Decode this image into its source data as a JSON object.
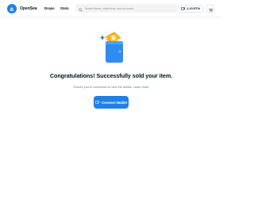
{
  "header": {
    "brand": "OpenSea",
    "nav": [
      "Drops",
      "Stats"
    ],
    "search_placeholder": "Search items, collections, and accounts",
    "balance": "2.15 ETH"
  },
  "main": {
    "headline": "Congratulations! Successfully sold your item.",
    "subtext": "Ensure you're connected to view the details.",
    "learn_more": "Learn more",
    "connect_button": "Connect Wallet"
  },
  "colors": {
    "accent": "#2081e2",
    "text": "#04111d",
    "muted": "#707a83",
    "coin": "#f5b72f"
  },
  "icons": [
    "opensea-logo-icon",
    "search-icon",
    "wallet-icon",
    "cart-icon",
    "coin-icon",
    "sparkle-icon"
  ]
}
